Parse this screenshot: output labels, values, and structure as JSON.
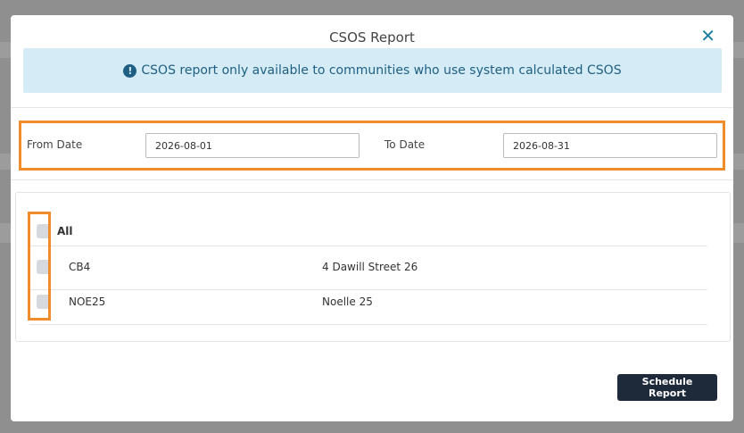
{
  "modal": {
    "title": "CSOS Report",
    "close_symbol": "✕",
    "alert": {
      "icon": "exclamation-circle-icon",
      "text": "CSOS report only available to communities who use system calculated CSOS"
    },
    "date_range": {
      "from_label": "From Date",
      "from_value": "2026-08-01",
      "to_label": "To Date",
      "to_value": "2026-08-31"
    },
    "list": {
      "all_label": "All",
      "rows": [
        {
          "code": "CB4",
          "name": "4 Dawill Street 26"
        },
        {
          "code": "NOE25",
          "name": "Noelle 25"
        }
      ]
    },
    "schedule_button": "Schedule Report"
  },
  "colors": {
    "highlight": "#f08c2a",
    "alert_bg": "#d5ecf6",
    "alert_text": "#1f5f83",
    "button_bg": "#1e2a3a"
  }
}
